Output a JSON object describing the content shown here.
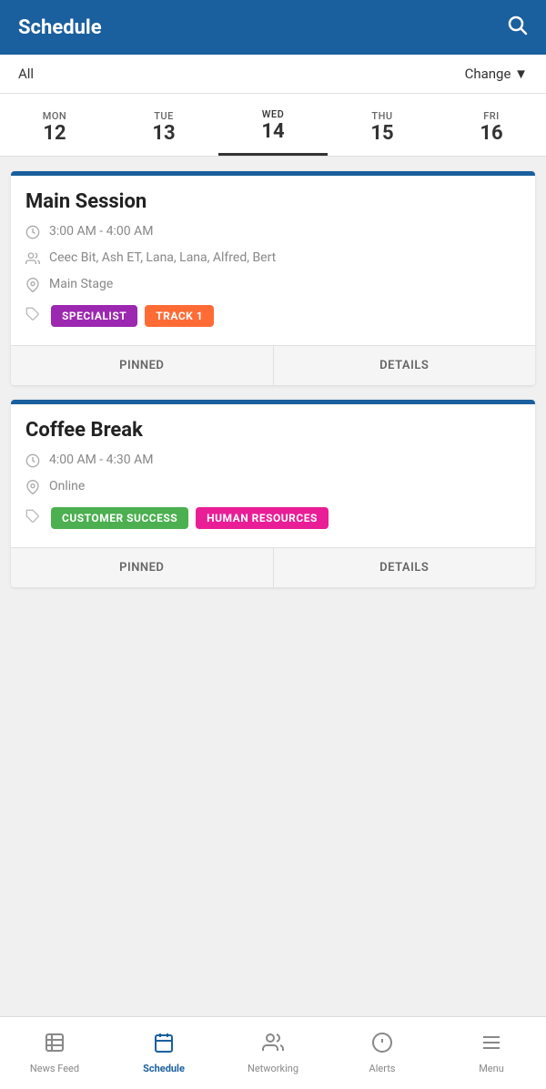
{
  "header": {
    "title": "Schedule",
    "search_icon": "🔍"
  },
  "filter": {
    "label": "All",
    "change_label": "Change ▼"
  },
  "days": [
    {
      "label": "MON",
      "number": "12",
      "active": false
    },
    {
      "label": "TUE",
      "number": "13",
      "active": false
    },
    {
      "label": "WED",
      "number": "14",
      "active": true
    },
    {
      "label": "THU",
      "number": "15",
      "active": false
    },
    {
      "label": "FRI",
      "number": "16",
      "active": false
    }
  ],
  "sessions": [
    {
      "id": "session-1",
      "title": "Main Session",
      "time": "3:00 AM - 4:00 AM",
      "speakers": "Ceec Bit, Ash ET, Lana, Lana, Alfred, Bert",
      "location": "Main Stage",
      "tags": [
        {
          "label": "SPECIALIST",
          "color": "purple"
        },
        {
          "label": "TRACK 1",
          "color": "orange"
        }
      ],
      "pinned_label": "PINNED",
      "details_label": "DETAILS"
    },
    {
      "id": "session-2",
      "title": "Coffee Break",
      "time": "4:00 AM - 4:30 AM",
      "location": "Online",
      "tags": [
        {
          "label": "CUSTOMER SUCCESS",
          "color": "green"
        },
        {
          "label": "HUMAN RESOURCES",
          "color": "pink"
        }
      ],
      "pinned_label": "PINNED",
      "details_label": "DETAILS"
    }
  ],
  "bottom_nav": [
    {
      "id": "news-feed",
      "icon": "news",
      "label": "News Feed",
      "active": false
    },
    {
      "id": "schedule",
      "icon": "schedule",
      "label": "Schedule",
      "active": true
    },
    {
      "id": "networking",
      "icon": "networking",
      "label": "Networking",
      "active": false
    },
    {
      "id": "alerts",
      "icon": "alerts",
      "label": "Alerts",
      "active": false
    },
    {
      "id": "menu",
      "icon": "menu",
      "label": "Menu",
      "active": false
    }
  ]
}
